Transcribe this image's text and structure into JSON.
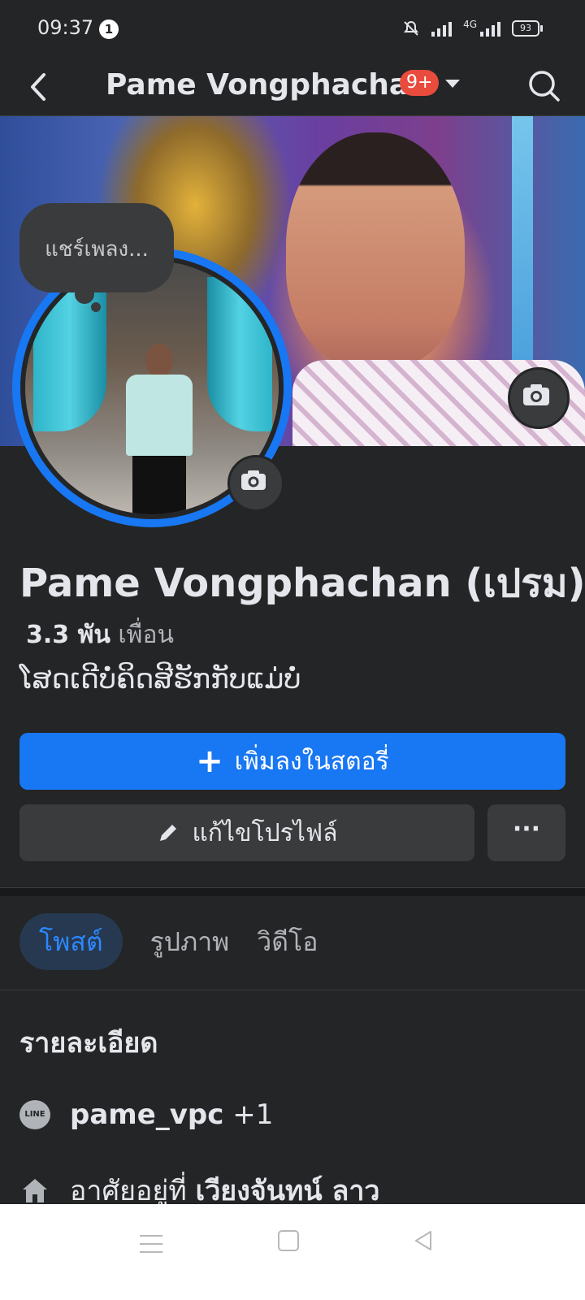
{
  "status_bar": {
    "time": "09:37",
    "notification_count": "1",
    "network": "4G",
    "battery": "93"
  },
  "header": {
    "title": "Pame Vongphachan",
    "badge": "9+"
  },
  "share_bubble": {
    "text": "แชร์เพลง..."
  },
  "profile": {
    "name": "Pame Vongphachan (เปรม)",
    "friends_count": "3.3 พัน",
    "friends_label": "เพื่อน",
    "bio": "ໂສດເດີບໍ່ຄິດສີຮັກກັບແມ່ບໍ່"
  },
  "actions": {
    "add_story": "เพิ่มลงในสตอรี่",
    "edit_profile": "แก้ไขโปรไฟล์",
    "more": "···"
  },
  "tabs": [
    {
      "label": "โพสต์"
    },
    {
      "label": "รูปภาพ"
    },
    {
      "label": "วิดีโอ"
    }
  ],
  "details": {
    "title": "รายละเอียด",
    "line_icon_text": "LINE",
    "line_id": "pame_vpc",
    "line_extra": "+1",
    "lives_in_prefix": "อาศัยอยู่ที่",
    "lives_in_place": "เวียงจันทน์ ลาว"
  },
  "colors": {
    "accent": "#1877f2",
    "background": "#242526",
    "button": "#3a3b3c",
    "badge": "#e94b3c"
  }
}
